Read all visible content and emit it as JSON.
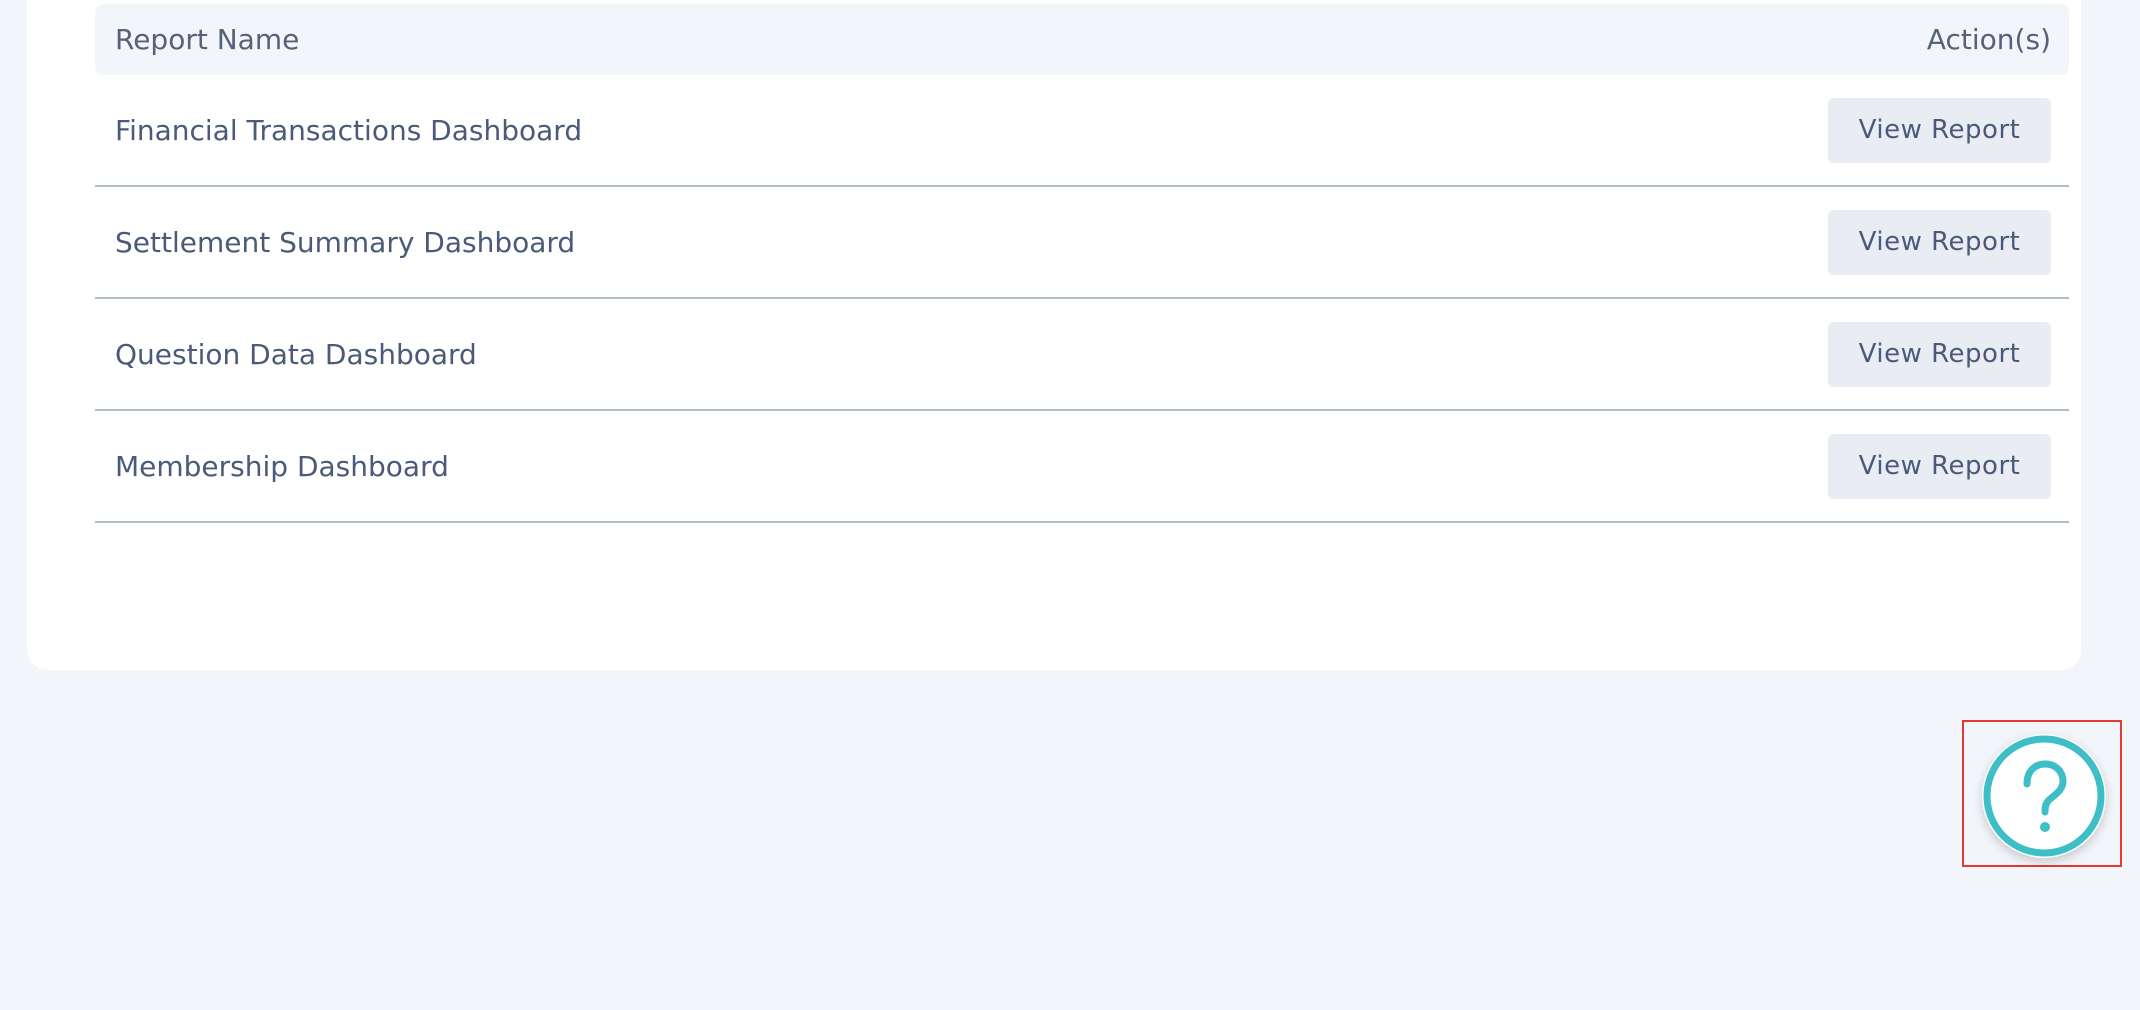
{
  "table": {
    "header": {
      "name_label": "Report Name",
      "actions_label": "Action(s)"
    },
    "rows": [
      {
        "name": "Financial Transactions Dashboard",
        "action": "View Report"
      },
      {
        "name": "Settlement Summary Dashboard",
        "action": "View Report"
      },
      {
        "name": "Question Data Dashboard",
        "action": "View Report"
      },
      {
        "name": "Membership Dashboard",
        "action": "View Report"
      }
    ]
  },
  "help": {
    "icon": "question-circle-icon",
    "accent_color": "#3ebec6"
  },
  "colors": {
    "page_background": "#f2f5f9",
    "card_background": "#ffffff",
    "text": "#4b5a78",
    "button_background": "#e9edf3",
    "divider": "#aebccb",
    "highlight_border": "#e53935"
  }
}
